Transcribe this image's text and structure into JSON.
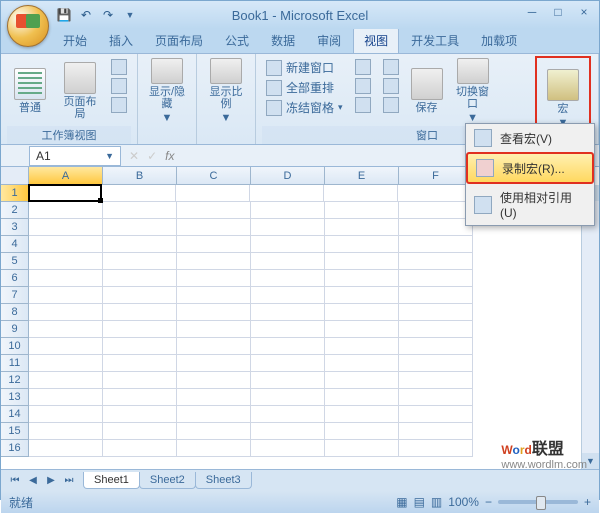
{
  "title": "Book1 - Microsoft Excel",
  "tabs": [
    "开始",
    "插入",
    "页面布局",
    "公式",
    "数据",
    "审阅",
    "视图",
    "开发工具",
    "加载项"
  ],
  "active_tab": "视图",
  "ribbon": {
    "group1": {
      "label": "工作簿视图",
      "normal": "普通",
      "pagelayout": "页面布局"
    },
    "group2": {
      "label": "显示/隐藏"
    },
    "group3": {
      "label": "显示比例"
    },
    "group4": {
      "label": "窗口",
      "new": "新建窗口",
      "arrange": "全部重排",
      "freeze": "冻结窗格",
      "save": "保存",
      "switch": "切换窗口"
    },
    "macro": "宏"
  },
  "menu": {
    "view": "查看宏(V)",
    "record": "录制宏(R)...",
    "relative": "使用相对引用(U)"
  },
  "namebox": "A1",
  "columns": [
    "A",
    "B",
    "C",
    "D",
    "E",
    "F"
  ],
  "rows": [
    "1",
    "2",
    "3",
    "4",
    "5",
    "6",
    "7",
    "8",
    "9",
    "10",
    "11",
    "12",
    "13",
    "14",
    "15",
    "16"
  ],
  "sheets": [
    "Sheet1",
    "Sheet2",
    "Sheet3"
  ],
  "status": "就绪",
  "zoom": "100%",
  "watermark": {
    "brand": "Word",
    "suffix": "联盟",
    "url": "www.wordlm.com"
  }
}
